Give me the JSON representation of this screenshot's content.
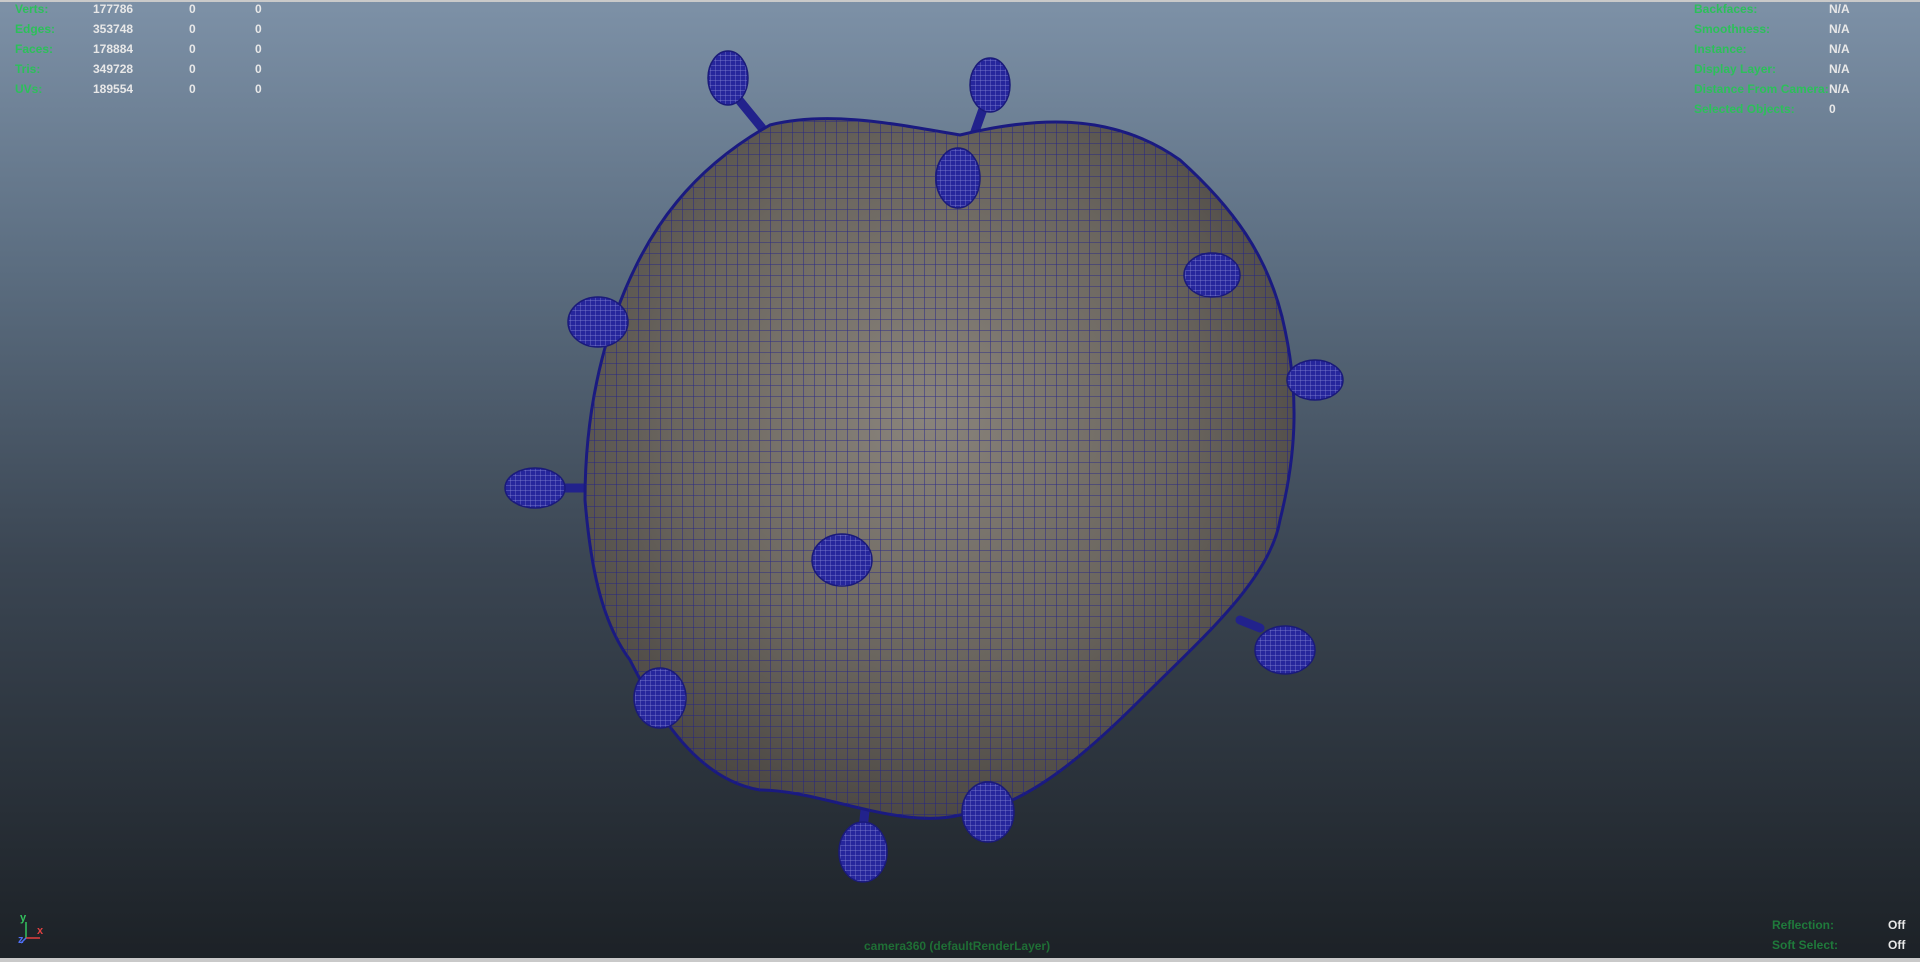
{
  "stats": [
    {
      "label": "Verts:",
      "v1": "177786",
      "v2": "0",
      "v3": "0"
    },
    {
      "label": "Edges:",
      "v1": "353748",
      "v2": "0",
      "v3": "0"
    },
    {
      "label": "Faces:",
      "v1": "178884",
      "v2": "0",
      "v3": "0"
    },
    {
      "label": "Tris:",
      "v1": "349728",
      "v2": "0",
      "v3": "0"
    },
    {
      "label": "UVs:",
      "v1": "189554",
      "v2": "0",
      "v3": "0"
    }
  ],
  "info": [
    {
      "label": "Backfaces:",
      "value": "N/A"
    },
    {
      "label": "Smoothness:",
      "value": "N/A"
    },
    {
      "label": "Instance:",
      "value": "N/A"
    },
    {
      "label": "Display Layer:",
      "value": "N/A"
    },
    {
      "label": "Distance From Camera:",
      "value": "N/A"
    },
    {
      "label": "Selected Objects:",
      "value": "0"
    }
  ],
  "bottom_right": [
    {
      "label": "Reflection:",
      "value": "Off"
    },
    {
      "label": "Soft Select:",
      "value": "Off"
    }
  ],
  "camera": {
    "label": "camera360 (defaultRenderLayer)"
  },
  "axis": {
    "y": "y",
    "x": "x",
    "z": "z"
  },
  "colors": {
    "hud_label": "#2cc05a",
    "hud_value": "#e8e8e8",
    "wireframe": "#1f1f8f",
    "surface": "#6f6962"
  },
  "icons": {
    "axis_gizmo": "axis-gizmo-icon"
  }
}
